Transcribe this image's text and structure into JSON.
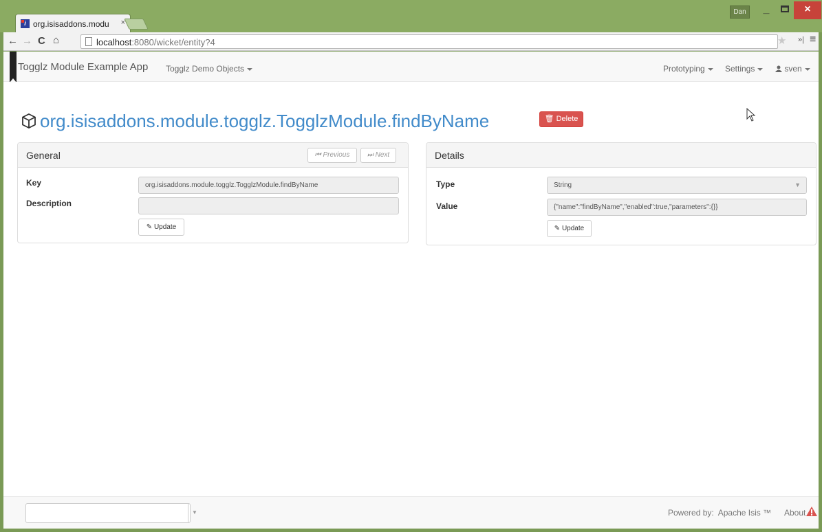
{
  "browser": {
    "tab_title": "org.isisaddons.modu",
    "tab_close": "×",
    "user_badge": "Dan",
    "url_host": "localhost",
    "url_rest": ":8080/wicket/entity?4"
  },
  "navbar": {
    "brand": "Togglz Module Example App",
    "menu_demo": "Togglz Demo Objects",
    "menu_prototyping": "Prototyping",
    "menu_settings": "Settings",
    "menu_user": "sven"
  },
  "entity": {
    "title": "org.isisaddons.module.togglz.TogglzModule.findByName",
    "delete_label": "Delete"
  },
  "general": {
    "heading": "General",
    "previous_label": "Previous",
    "next_label": "Next",
    "key_label": "Key",
    "key_value": "org.isisaddons.module.togglz.TogglzModule.findByName",
    "description_label": "Description",
    "description_value": "",
    "update_label": "Update"
  },
  "details": {
    "heading": "Details",
    "type_label": "Type",
    "type_value": "String",
    "value_label": "Value",
    "value_value": "{\"name\":\"findByName\",\"enabled\":true,\"parameters\":{}}",
    "update_label": "Update"
  },
  "footer": {
    "powered_label": "Powered by:",
    "powered_value": "Apache Isis ™",
    "about_label": "About"
  },
  "colors": {
    "link": "#428bca",
    "danger": "#d9534f",
    "frame": "#8bab62"
  }
}
